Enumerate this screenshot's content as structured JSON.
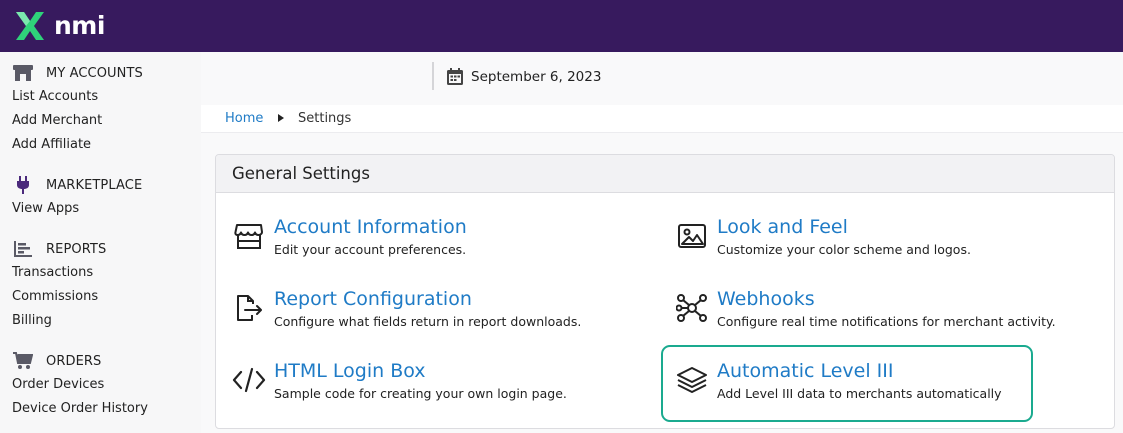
{
  "brand": {
    "logo_text": "nmi",
    "logo_color": "#2fd27a"
  },
  "colors": {
    "topbar": "#371a5e",
    "link": "#1f7bc6",
    "highlight": "#1aaa8f"
  },
  "sidebar": {
    "sections": [
      {
        "icon": "store-icon",
        "label": "MY ACCOUNTS",
        "links": [
          "List Accounts",
          "Add Merchant",
          "Add Affiliate"
        ]
      },
      {
        "icon": "plug-icon",
        "label": "MARKETPLACE",
        "links": [
          "View Apps"
        ]
      },
      {
        "icon": "bar-chart-icon",
        "label": "REPORTS",
        "links": [
          "Transactions",
          "Commissions",
          "Billing"
        ]
      },
      {
        "icon": "cart-icon",
        "label": "ORDERS",
        "links": [
          "Order Devices",
          "Device Order History"
        ]
      }
    ]
  },
  "header": {
    "date": "September 6, 2023"
  },
  "breadcrumb": {
    "home": "Home",
    "current": "Settings"
  },
  "panel": {
    "title": "General Settings",
    "items": [
      {
        "icon": "store-icon",
        "title": "Account Information",
        "description": "Edit your account preferences."
      },
      {
        "icon": "image-icon",
        "title": "Look and Feel",
        "description": "Customize your color scheme and logos."
      },
      {
        "icon": "file-export-icon",
        "title": "Report Configuration",
        "description": "Configure what fields return in report downloads."
      },
      {
        "icon": "network-icon",
        "title": "Webhooks",
        "description": "Configure real time notifications for merchant activity."
      },
      {
        "icon": "code-icon",
        "title": "HTML Login Box",
        "description": "Sample code for creating your own login page."
      },
      {
        "icon": "layers-icon",
        "title": "Automatic Level III",
        "description": "Add Level III data to merchants automatically"
      }
    ]
  }
}
